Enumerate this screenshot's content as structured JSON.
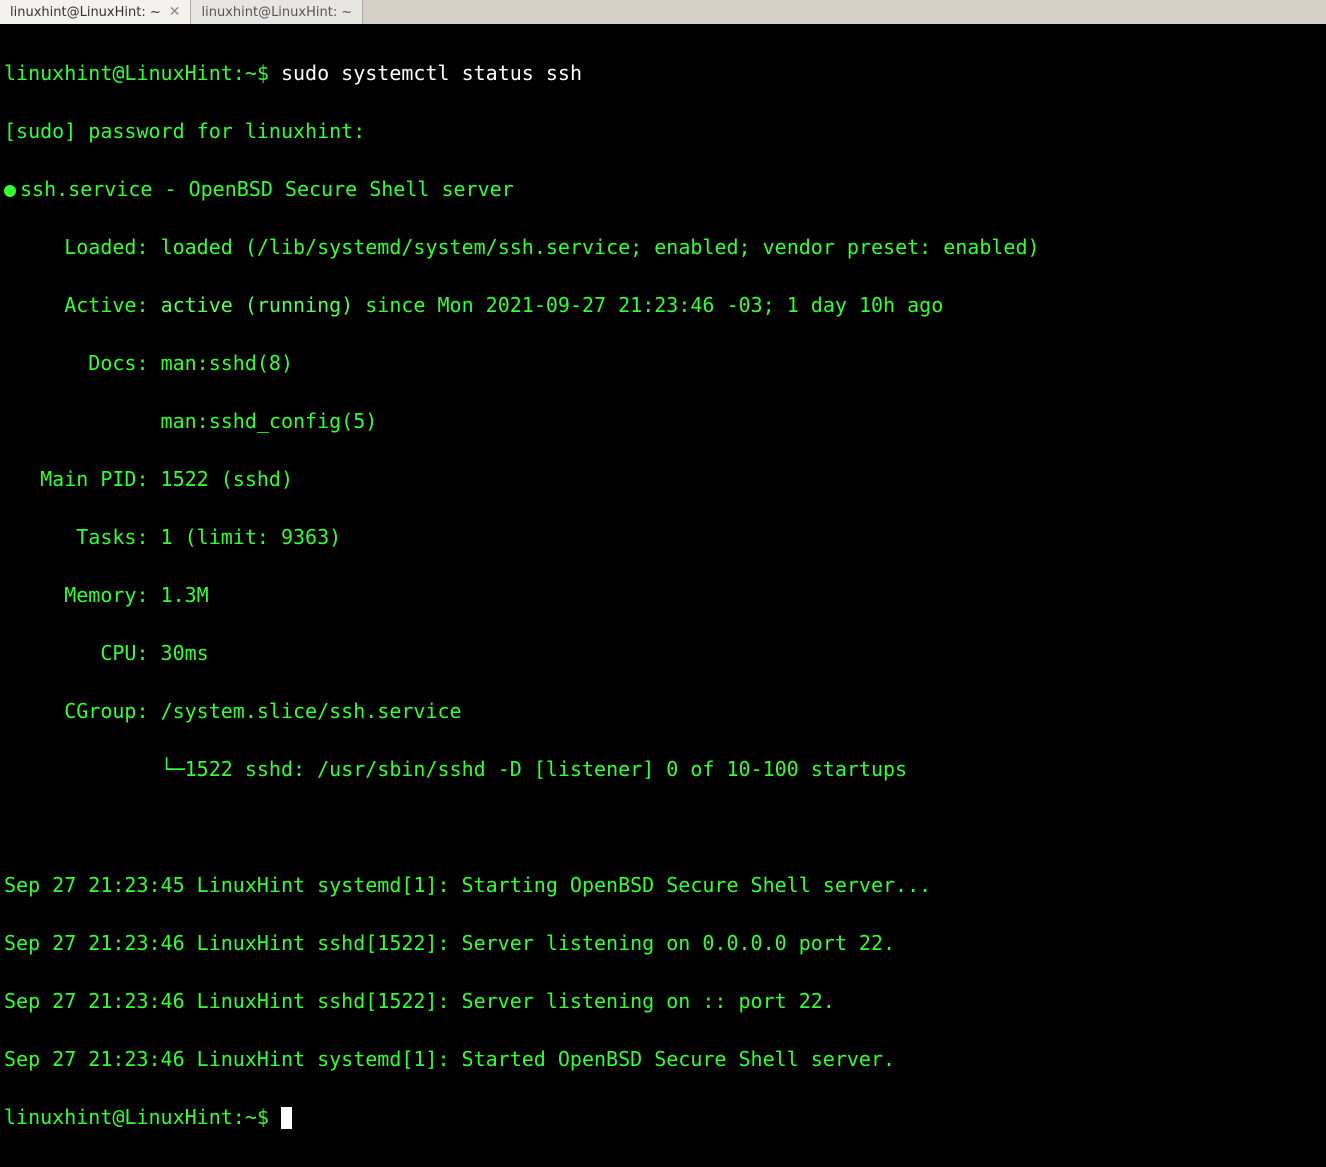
{
  "tabs": [
    {
      "title": "linuxhint@LinuxHint: ~",
      "active": true,
      "close": "✕"
    },
    {
      "title": "linuxhint@LinuxHint: ~",
      "active": false,
      "close": ""
    }
  ],
  "prompt": {
    "userhost": "linuxhint@LinuxHint",
    "path": "~",
    "symbol": "$"
  },
  "command": "sudo systemctl status ssh",
  "sudo_prompt": "[sudo] password for linuxhint:",
  "service": {
    "name": "ssh.service",
    "desc": "OpenBSD Secure Shell server",
    "loaded_label": "Loaded:",
    "loaded_value": "loaded (/lib/systemd/system/ssh.service; enabled; vendor preset: enabled)",
    "active_label": "Active:",
    "active_state": "active (running)",
    "active_since": " since Mon 2021-09-27 21:23:46 -03; 1 day 10h ago",
    "docs_label": "Docs:",
    "docs1": "man:sshd(8)",
    "docs2": "man:sshd_config(5)",
    "mainpid_label": "Main PID:",
    "mainpid_value": "1522 (sshd)",
    "tasks_label": "Tasks:",
    "tasks_value": "1 (limit: 9363)",
    "memory_label": "Memory:",
    "memory_value": "1.3M",
    "cpu_label": "CPU:",
    "cpu_value": "30ms",
    "cgroup_label": "CGroup:",
    "cgroup_value": "/system.slice/ssh.service",
    "cgroup_tree": "└─1522 sshd: /usr/sbin/sshd -D [listener] 0 of 10-100 startups"
  },
  "logs": [
    "Sep 27 21:23:45 LinuxHint systemd[1]: Starting OpenBSD Secure Shell server...",
    "Sep 27 21:23:46 LinuxHint sshd[1522]: Server listening on 0.0.0.0 port 22.",
    "Sep 27 21:23:46 LinuxHint sshd[1522]: Server listening on :: port 22.",
    "Sep 27 21:23:46 LinuxHint systemd[1]: Started OpenBSD Secure Shell server."
  ]
}
